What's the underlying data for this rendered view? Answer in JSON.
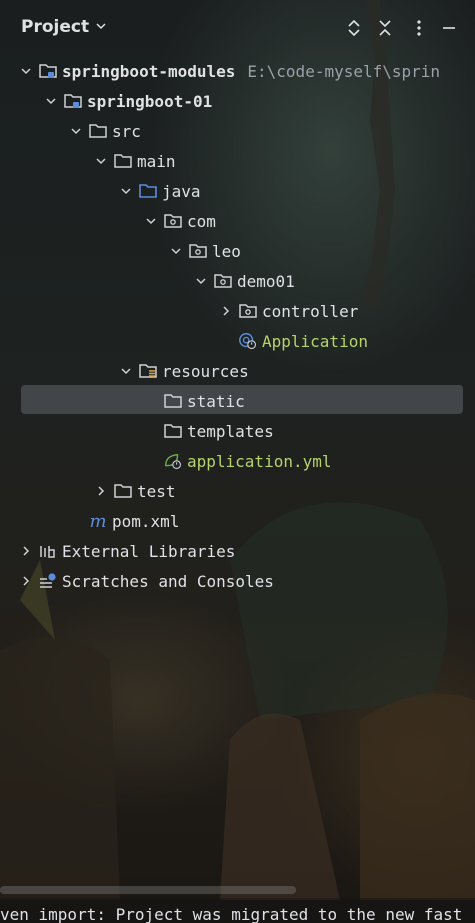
{
  "header": {
    "title": "Project",
    "icons": [
      "chevron-down-icon",
      "expand-collapse-icon",
      "collapse-all-icon",
      "more-vertical-icon",
      "minimize-icon"
    ]
  },
  "tree": {
    "root": {
      "label": "springboot-modules",
      "path": "E:\\code-myself\\sprin"
    },
    "module": {
      "label": "springboot-01"
    },
    "src": "src",
    "main": "main",
    "java": "java",
    "com": "com",
    "leo": "leo",
    "demo01": "demo01",
    "controller": "controller",
    "application_class": "Application",
    "resources": "resources",
    "static": "static",
    "templates": "templates",
    "application_yml": "application.yml",
    "test": "test",
    "pom": "pom.xml",
    "pom_icon_glyph": "m",
    "external_libraries": "External Libraries",
    "scratches": "Scratches and Consoles"
  },
  "status_bar": {
    "text": "ven import: Project was migrated to the new fast"
  },
  "colors": {
    "text": "#dfe1e5",
    "path": "#9da0a8",
    "accent_green": "#b6d36a",
    "folder_blue": "#5b8dd9",
    "selection": "#5d626b"
  }
}
